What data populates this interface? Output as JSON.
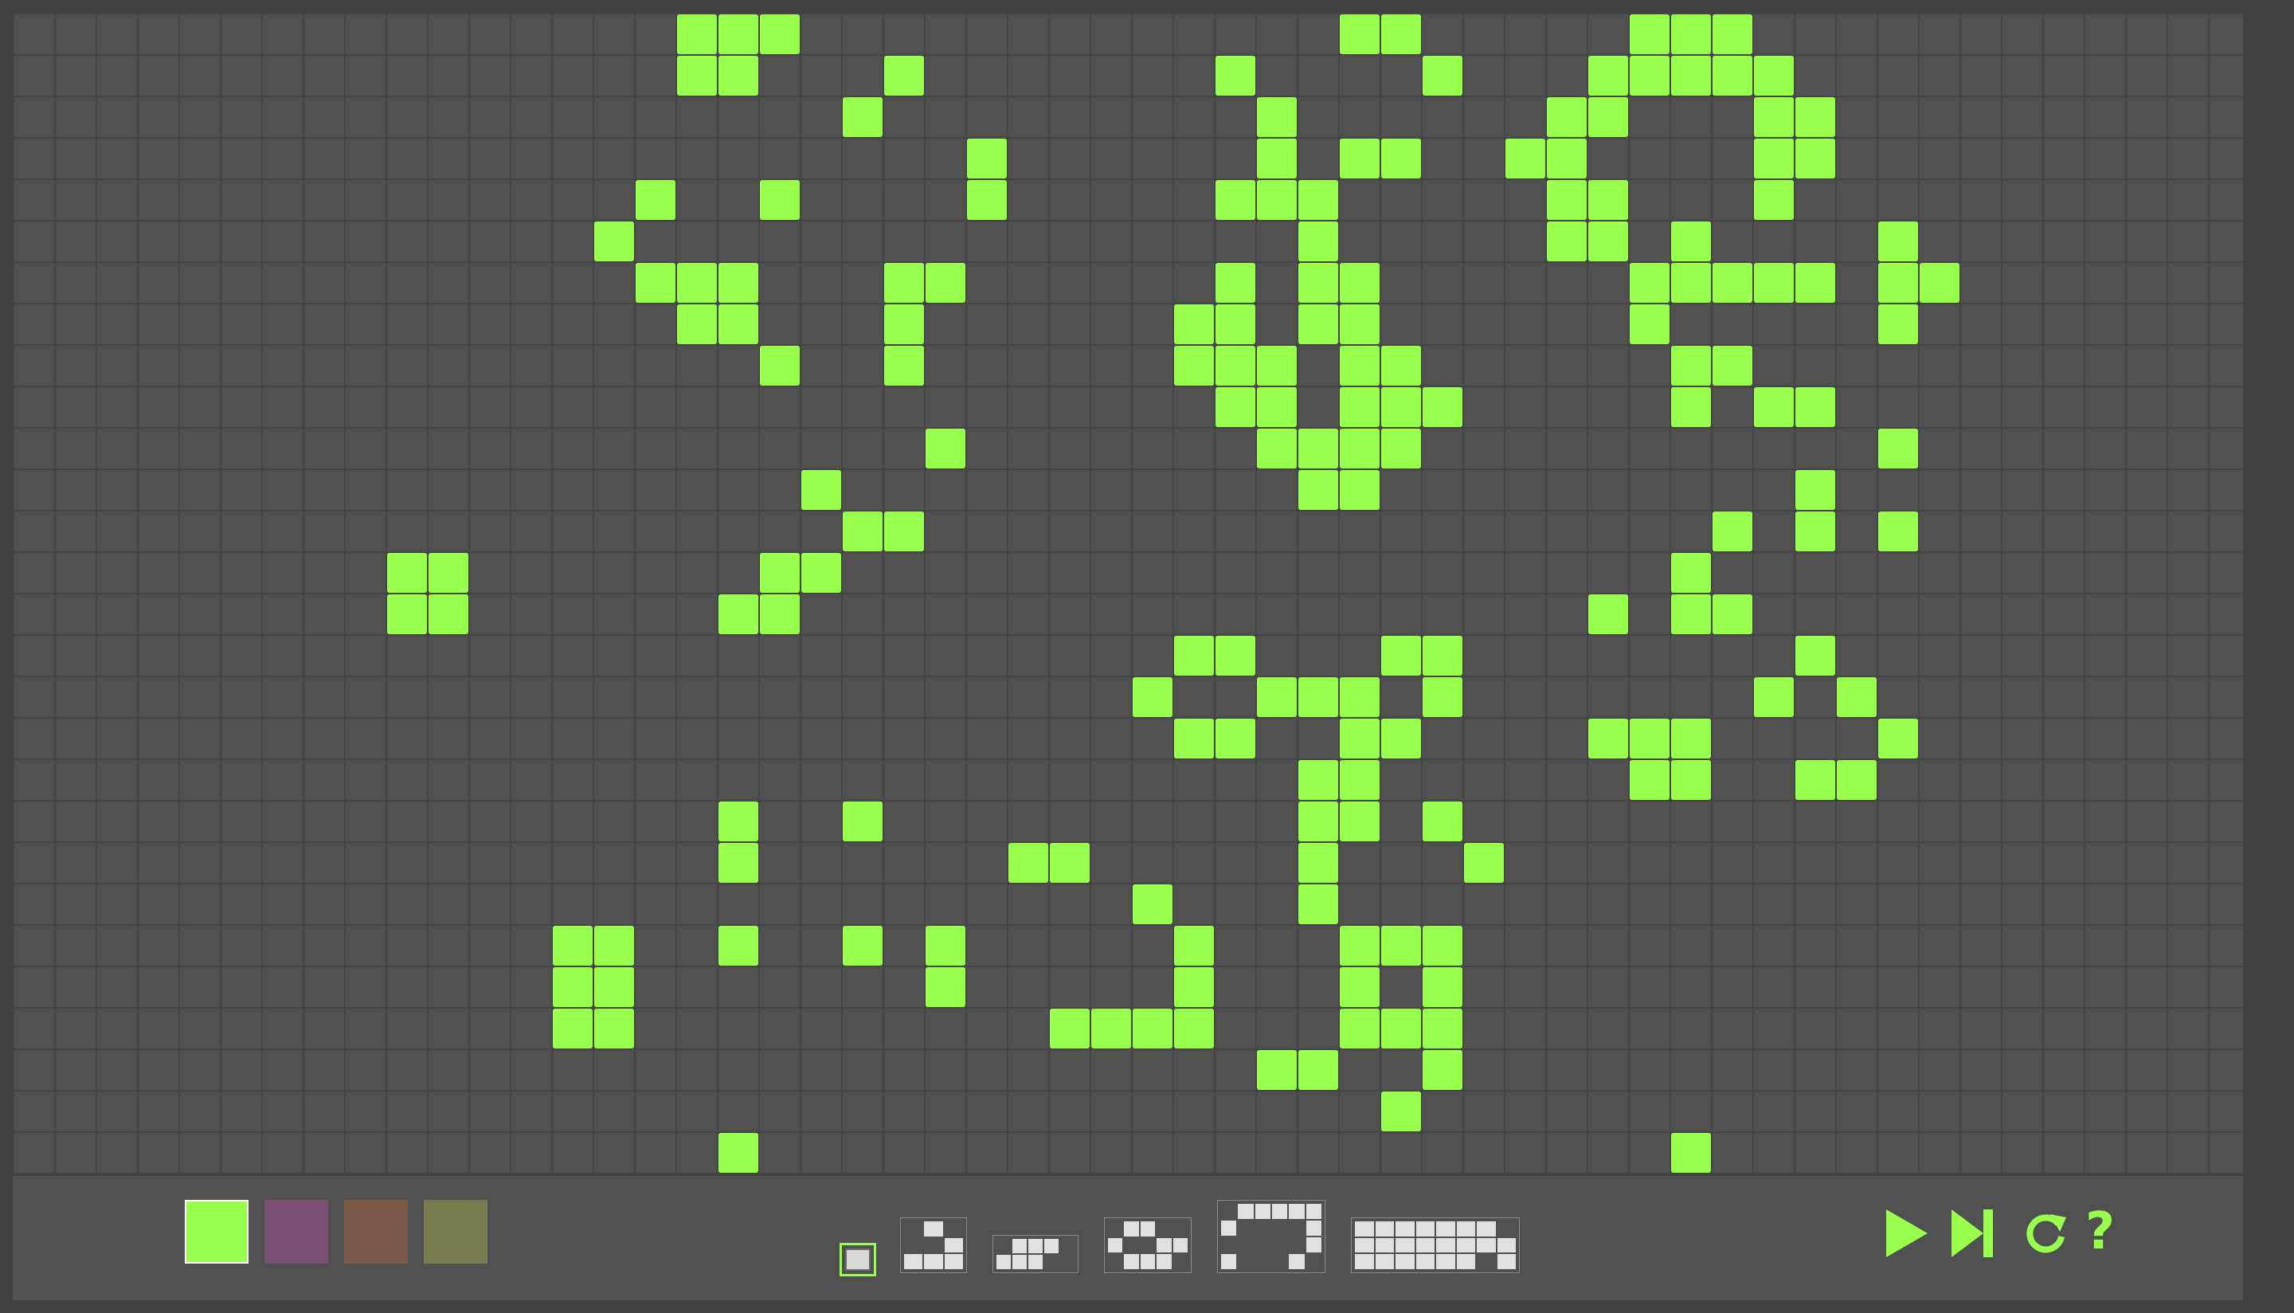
{
  "accent_color": "#99ff4d",
  "grid": {
    "cols": 54,
    "rows": 28,
    "live_color": "#99ff4d",
    "live_cells": [
      [
        16,
        0
      ],
      [
        17,
        0
      ],
      [
        18,
        0
      ],
      [
        32,
        0
      ],
      [
        33,
        0
      ],
      [
        39,
        0
      ],
      [
        40,
        0
      ],
      [
        41,
        0
      ],
      [
        16,
        1
      ],
      [
        17,
        1
      ],
      [
        21,
        1
      ],
      [
        29,
        1
      ],
      [
        34,
        1
      ],
      [
        38,
        1
      ],
      [
        39,
        1
      ],
      [
        40,
        1
      ],
      [
        41,
        1
      ],
      [
        42,
        1
      ],
      [
        20,
        2
      ],
      [
        30,
        2
      ],
      [
        37,
        2
      ],
      [
        38,
        2
      ],
      [
        42,
        2
      ],
      [
        43,
        2
      ],
      [
        23,
        3
      ],
      [
        30,
        3
      ],
      [
        32,
        3
      ],
      [
        33,
        3
      ],
      [
        36,
        3
      ],
      [
        37,
        3
      ],
      [
        42,
        3
      ],
      [
        43,
        3
      ],
      [
        15,
        4
      ],
      [
        18,
        4
      ],
      [
        23,
        4
      ],
      [
        29,
        4
      ],
      [
        30,
        4
      ],
      [
        31,
        4
      ],
      [
        37,
        4
      ],
      [
        38,
        4
      ],
      [
        42,
        4
      ],
      [
        14,
        5
      ],
      [
        31,
        5
      ],
      [
        37,
        5
      ],
      [
        38,
        5
      ],
      [
        40,
        5
      ],
      [
        45,
        5
      ],
      [
        15,
        6
      ],
      [
        16,
        6
      ],
      [
        17,
        6
      ],
      [
        21,
        6
      ],
      [
        22,
        6
      ],
      [
        29,
        6
      ],
      [
        31,
        6
      ],
      [
        32,
        6
      ],
      [
        39,
        6
      ],
      [
        40,
        6
      ],
      [
        41,
        6
      ],
      [
        42,
        6
      ],
      [
        43,
        6
      ],
      [
        45,
        6
      ],
      [
        46,
        6
      ],
      [
        16,
        7
      ],
      [
        17,
        7
      ],
      [
        21,
        7
      ],
      [
        28,
        7
      ],
      [
        29,
        7
      ],
      [
        31,
        7
      ],
      [
        32,
        7
      ],
      [
        39,
        7
      ],
      [
        45,
        7
      ],
      [
        18,
        8
      ],
      [
        21,
        8
      ],
      [
        28,
        8
      ],
      [
        29,
        8
      ],
      [
        30,
        8
      ],
      [
        32,
        8
      ],
      [
        33,
        8
      ],
      [
        40,
        8
      ],
      [
        41,
        8
      ],
      [
        29,
        9
      ],
      [
        30,
        9
      ],
      [
        32,
        9
      ],
      [
        33,
        9
      ],
      [
        34,
        9
      ],
      [
        40,
        9
      ],
      [
        42,
        9
      ],
      [
        43,
        9
      ],
      [
        22,
        10
      ],
      [
        30,
        10
      ],
      [
        31,
        10
      ],
      [
        32,
        10
      ],
      [
        33,
        10
      ],
      [
        45,
        10
      ],
      [
        19,
        11
      ],
      [
        31,
        11
      ],
      [
        32,
        11
      ],
      [
        43,
        11
      ],
      [
        20,
        12
      ],
      [
        21,
        12
      ],
      [
        41,
        12
      ],
      [
        43,
        12
      ],
      [
        45,
        12
      ],
      [
        9,
        13
      ],
      [
        10,
        13
      ],
      [
        18,
        13
      ],
      [
        19,
        13
      ],
      [
        40,
        13
      ],
      [
        9,
        14
      ],
      [
        10,
        14
      ],
      [
        17,
        14
      ],
      [
        18,
        14
      ],
      [
        38,
        14
      ],
      [
        40,
        14
      ],
      [
        41,
        14
      ],
      [
        28,
        15
      ],
      [
        29,
        15
      ],
      [
        33,
        15
      ],
      [
        34,
        15
      ],
      [
        43,
        15
      ],
      [
        27,
        16
      ],
      [
        30,
        16
      ],
      [
        31,
        16
      ],
      [
        32,
        16
      ],
      [
        34,
        16
      ],
      [
        42,
        16
      ],
      [
        44,
        16
      ],
      [
        28,
        17
      ],
      [
        29,
        17
      ],
      [
        32,
        17
      ],
      [
        33,
        17
      ],
      [
        38,
        17
      ],
      [
        39,
        17
      ],
      [
        40,
        17
      ],
      [
        45,
        17
      ],
      [
        31,
        18
      ],
      [
        32,
        18
      ],
      [
        39,
        18
      ],
      [
        40,
        18
      ],
      [
        43,
        18
      ],
      [
        44,
        18
      ],
      [
        17,
        19
      ],
      [
        20,
        19
      ],
      [
        31,
        19
      ],
      [
        32,
        19
      ],
      [
        34,
        19
      ],
      [
        17,
        20
      ],
      [
        24,
        20
      ],
      [
        25,
        20
      ],
      [
        31,
        20
      ],
      [
        35,
        20
      ],
      [
        27,
        21
      ],
      [
        31,
        21
      ],
      [
        13,
        22
      ],
      [
        14,
        22
      ],
      [
        17,
        22
      ],
      [
        20,
        22
      ],
      [
        22,
        22
      ],
      [
        28,
        22
      ],
      [
        32,
        22
      ],
      [
        33,
        22
      ],
      [
        34,
        22
      ],
      [
        13,
        23
      ],
      [
        14,
        23
      ],
      [
        22,
        23
      ],
      [
        28,
        23
      ],
      [
        32,
        23
      ],
      [
        34,
        23
      ],
      [
        13,
        24
      ],
      [
        14,
        24
      ],
      [
        25,
        24
      ],
      [
        26,
        24
      ],
      [
        27,
        24
      ],
      [
        28,
        24
      ],
      [
        32,
        24
      ],
      [
        33,
        24
      ],
      [
        34,
        24
      ],
      [
        30,
        25
      ],
      [
        31,
        25
      ],
      [
        34,
        25
      ],
      [
        33,
        26
      ],
      [
        17,
        27
      ],
      [
        40,
        27
      ]
    ]
  },
  "palette": {
    "swatches": [
      {
        "name": "green",
        "color": "#99ff4d",
        "selected": true
      },
      {
        "name": "purple",
        "color": "#7a4f73",
        "selected": false
      },
      {
        "name": "brown",
        "color": "#7a5a47",
        "selected": false
      },
      {
        "name": "olive",
        "color": "#767a4d",
        "selected": false
      }
    ]
  },
  "patterns": [
    {
      "name": "single",
      "cols": 1,
      "rows": 1,
      "cells": [
        [
          0,
          0
        ]
      ]
    },
    {
      "name": "glider",
      "cols": 3,
      "rows": 3,
      "cells": [
        [
          1,
          0
        ],
        [
          2,
          1
        ],
        [
          0,
          2
        ],
        [
          1,
          2
        ],
        [
          2,
          2
        ]
      ]
    },
    {
      "name": "row",
      "cols": 5,
      "rows": 2,
      "cells": [
        [
          1,
          0
        ],
        [
          2,
          0
        ],
        [
          3,
          0
        ],
        [
          0,
          1
        ],
        [
          1,
          1
        ],
        [
          2,
          1
        ]
      ]
    },
    {
      "name": "spaceship",
      "cols": 5,
      "rows": 3,
      "cells": [
        [
          1,
          0
        ],
        [
          2,
          0
        ],
        [
          0,
          1
        ],
        [
          3,
          1
        ],
        [
          4,
          1
        ],
        [
          1,
          2
        ],
        [
          2,
          2
        ],
        [
          3,
          2
        ]
      ]
    },
    {
      "name": "large-spaceship",
      "cols": 6,
      "rows": 4,
      "cells": [
        [
          1,
          0
        ],
        [
          2,
          0
        ],
        [
          3,
          0
        ],
        [
          4,
          0
        ],
        [
          5,
          0
        ],
        [
          0,
          1
        ],
        [
          5,
          1
        ],
        [
          5,
          2
        ],
        [
          0,
          3
        ],
        [
          4,
          3
        ]
      ]
    },
    {
      "name": "grid-block",
      "cols": 8,
      "rows": 3,
      "cells": [
        [
          0,
          0
        ],
        [
          1,
          0
        ],
        [
          2,
          0
        ],
        [
          3,
          0
        ],
        [
          4,
          0
        ],
        [
          5,
          0
        ],
        [
          6,
          0
        ],
        [
          0,
          1
        ],
        [
          1,
          1
        ],
        [
          2,
          1
        ],
        [
          3,
          1
        ],
        [
          4,
          1
        ],
        [
          5,
          1
        ],
        [
          6,
          1
        ],
        [
          7,
          1
        ],
        [
          0,
          2
        ],
        [
          1,
          2
        ],
        [
          2,
          2
        ],
        [
          3,
          2
        ],
        [
          4,
          2
        ],
        [
          5,
          2
        ],
        [
          7,
          2
        ]
      ]
    }
  ],
  "controls": {
    "help_label": "?"
  }
}
